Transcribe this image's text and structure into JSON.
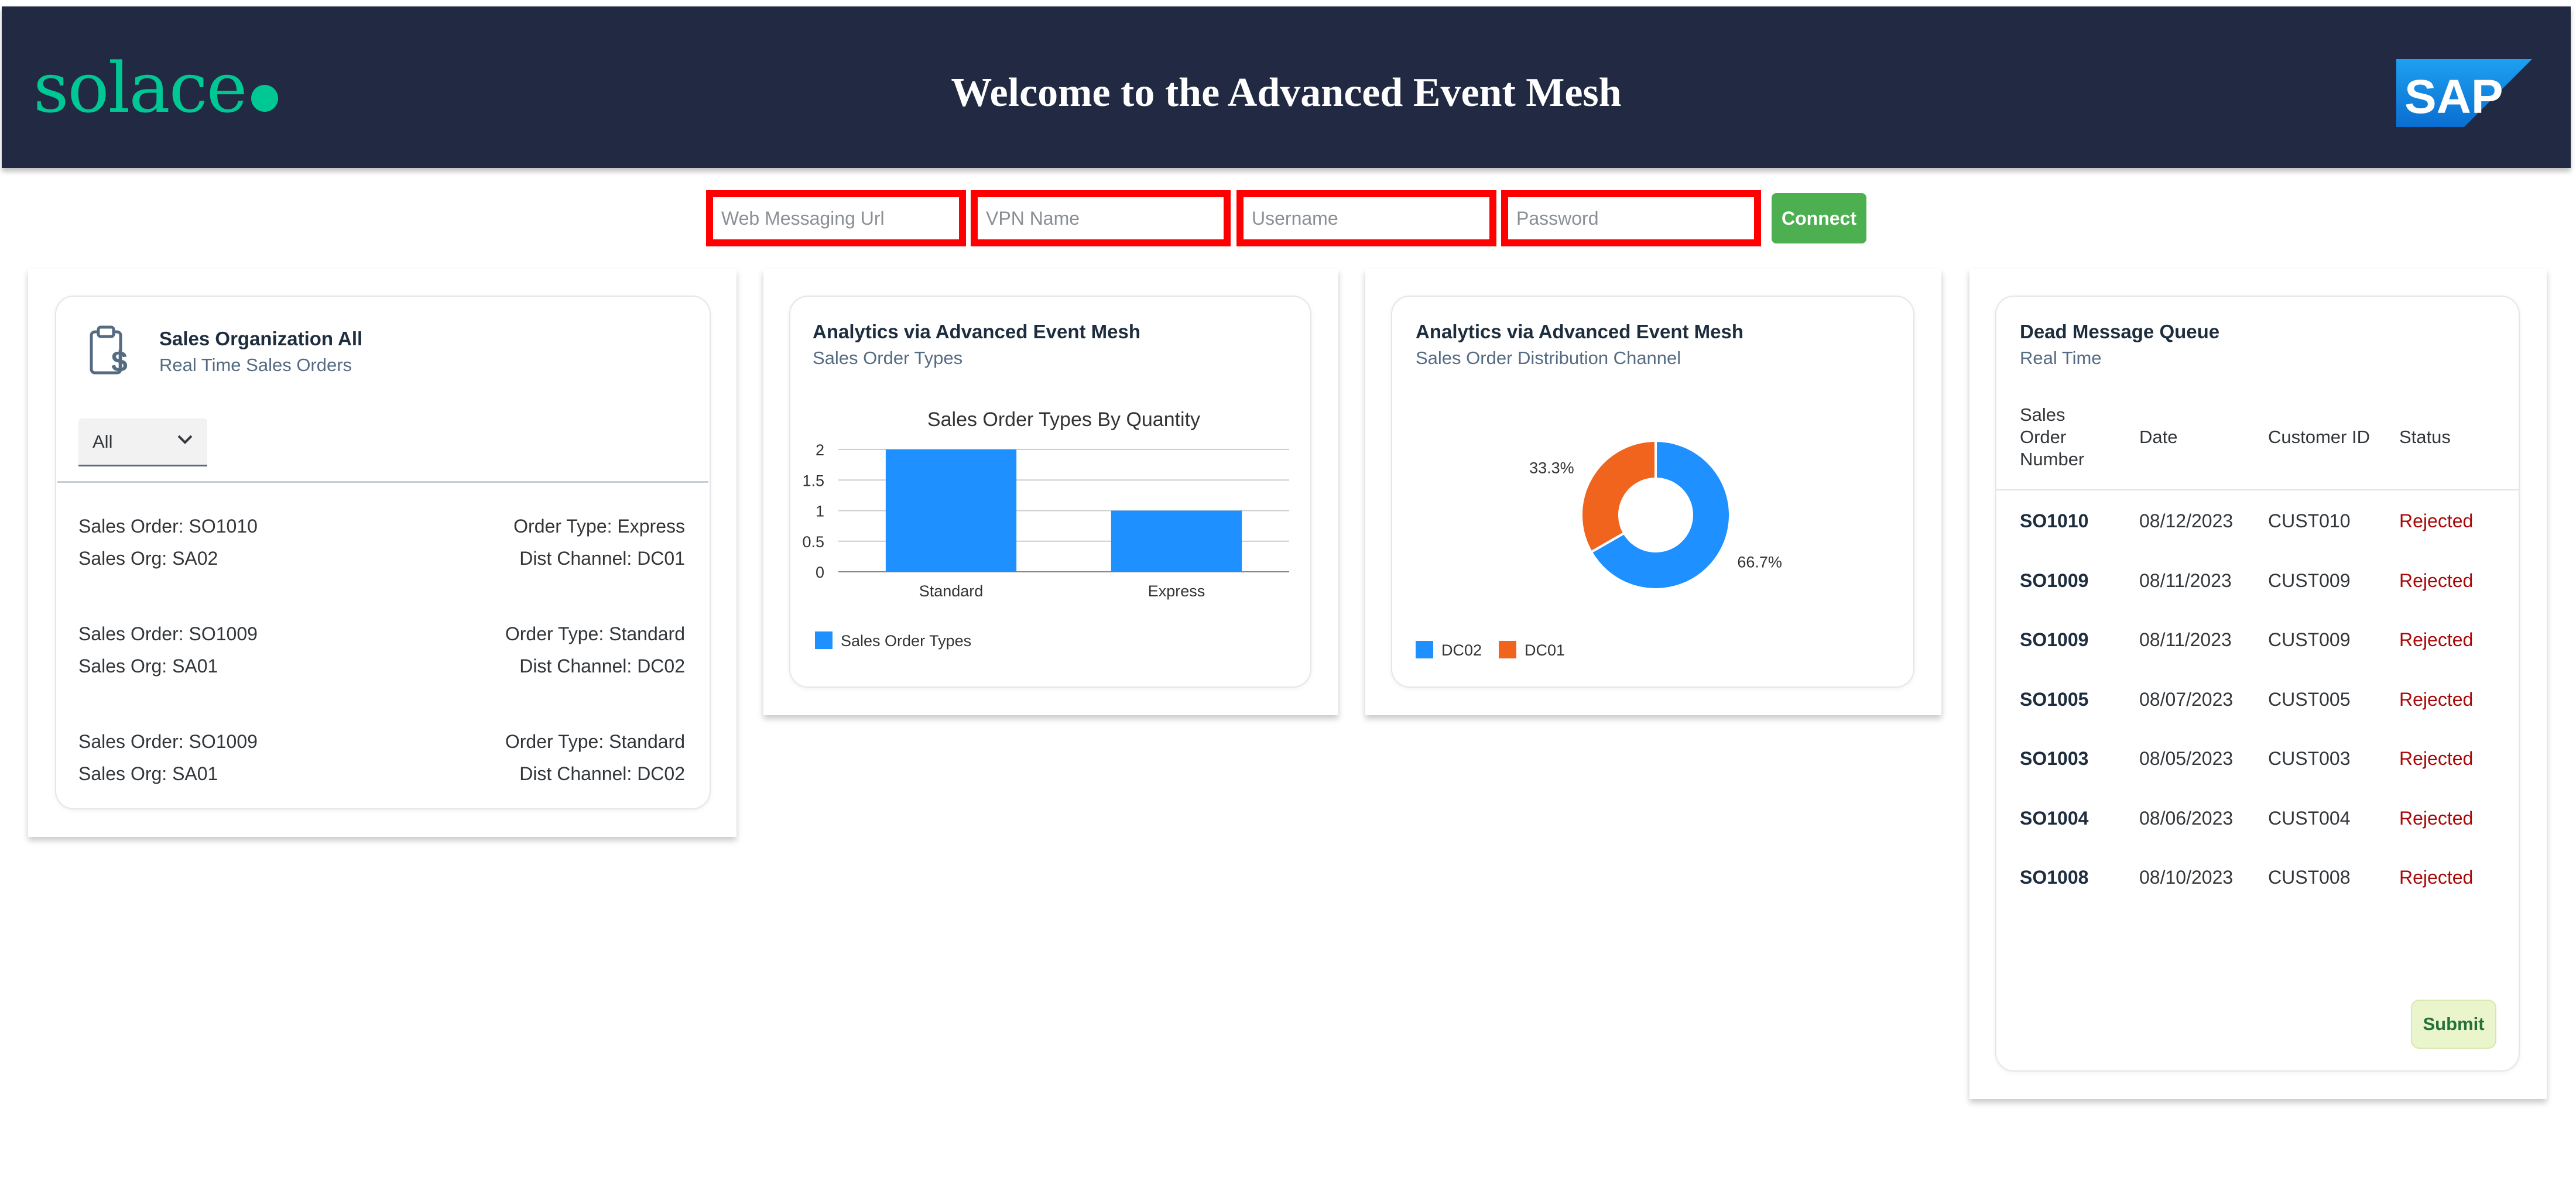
{
  "header": {
    "logo_text": "solace",
    "title": "Welcome to the Advanced Event Mesh",
    "sap_logo_text": "SAP"
  },
  "connection": {
    "url_placeholder": "Web Messaging Url",
    "vpn_placeholder": "VPN Name",
    "username_placeholder": "Username",
    "password_placeholder": "Password",
    "connect_label": "Connect"
  },
  "sales_card": {
    "title": "Sales Organization All",
    "subtitle": "Real Time Sales Orders",
    "filter_value": "All",
    "icon": "clipboard-dollar-icon",
    "orders": [
      {
        "order": "Sales Order: SO1010",
        "org": "Sales Org: SA02",
        "type": "Order Type: Express",
        "channel": "Dist Channel: DC01"
      },
      {
        "order": "Sales Order: SO1009",
        "org": "Sales Org: SA01",
        "type": "Order Type: Standard",
        "channel": "Dist Channel: DC02"
      },
      {
        "order": "Sales Order: SO1009",
        "org": "Sales Org: SA01",
        "type": "Order Type: Standard",
        "channel": "Dist Channel: DC02"
      }
    ]
  },
  "types_card": {
    "title": "Analytics via Advanced Event Mesh",
    "subtitle": "Sales Order Types"
  },
  "channel_card": {
    "title": "Analytics via Advanced Event Mesh",
    "subtitle": "Sales Order Distribution Channel"
  },
  "chart_data": [
    {
      "type": "bar",
      "title": "Sales Order Types By Quantity",
      "categories": [
        "Standard",
        "Express"
      ],
      "series": [
        {
          "name": "Sales Order Types",
          "values": [
            2,
            1
          ]
        }
      ],
      "yticks": [
        "0",
        "0.5",
        "1",
        "1.5",
        "2"
      ],
      "ylim": [
        0,
        2
      ],
      "grid": true,
      "legend": "bottom-left",
      "color": "#1e90ff"
    },
    {
      "type": "pie",
      "donut": true,
      "categories": [
        "DC02",
        "DC01"
      ],
      "values": [
        66.7,
        33.3
      ],
      "labels": [
        "66.7%",
        "33.3%"
      ],
      "colors": [
        "#1e90ff",
        "#f0641e"
      ],
      "legend": "bottom-left"
    }
  ],
  "dmq_card": {
    "title": "Dead Message Queue",
    "subtitle": "Real Time",
    "columns": [
      "Sales Order Number",
      "Date",
      "Customer ID",
      "Status"
    ],
    "rows": [
      {
        "id": "SO1010",
        "date": "08/12/2023",
        "customer": "CUST010",
        "status": "Rejected"
      },
      {
        "id": "SO1009",
        "date": "08/11/2023",
        "customer": "CUST009",
        "status": "Rejected"
      },
      {
        "id": "SO1009",
        "date": "08/11/2023",
        "customer": "CUST009",
        "status": "Rejected"
      },
      {
        "id": "SO1005",
        "date": "08/07/2023",
        "customer": "CUST005",
        "status": "Rejected"
      },
      {
        "id": "SO1003",
        "date": "08/05/2023",
        "customer": "CUST003",
        "status": "Rejected"
      },
      {
        "id": "SO1004",
        "date": "08/06/2023",
        "customer": "CUST004",
        "status": "Rejected"
      },
      {
        "id": "SO1008",
        "date": "08/10/2023",
        "customer": "CUST008",
        "status": "Rejected"
      }
    ],
    "submit_label": "Submit"
  },
  "colors": {
    "header_bg": "#212a42",
    "brand_green": "#00c895",
    "connect_green": "#4caf50",
    "bar_blue": "#1e90ff",
    "donut_orange": "#f0641e",
    "rejected_red": "#aa0808"
  }
}
